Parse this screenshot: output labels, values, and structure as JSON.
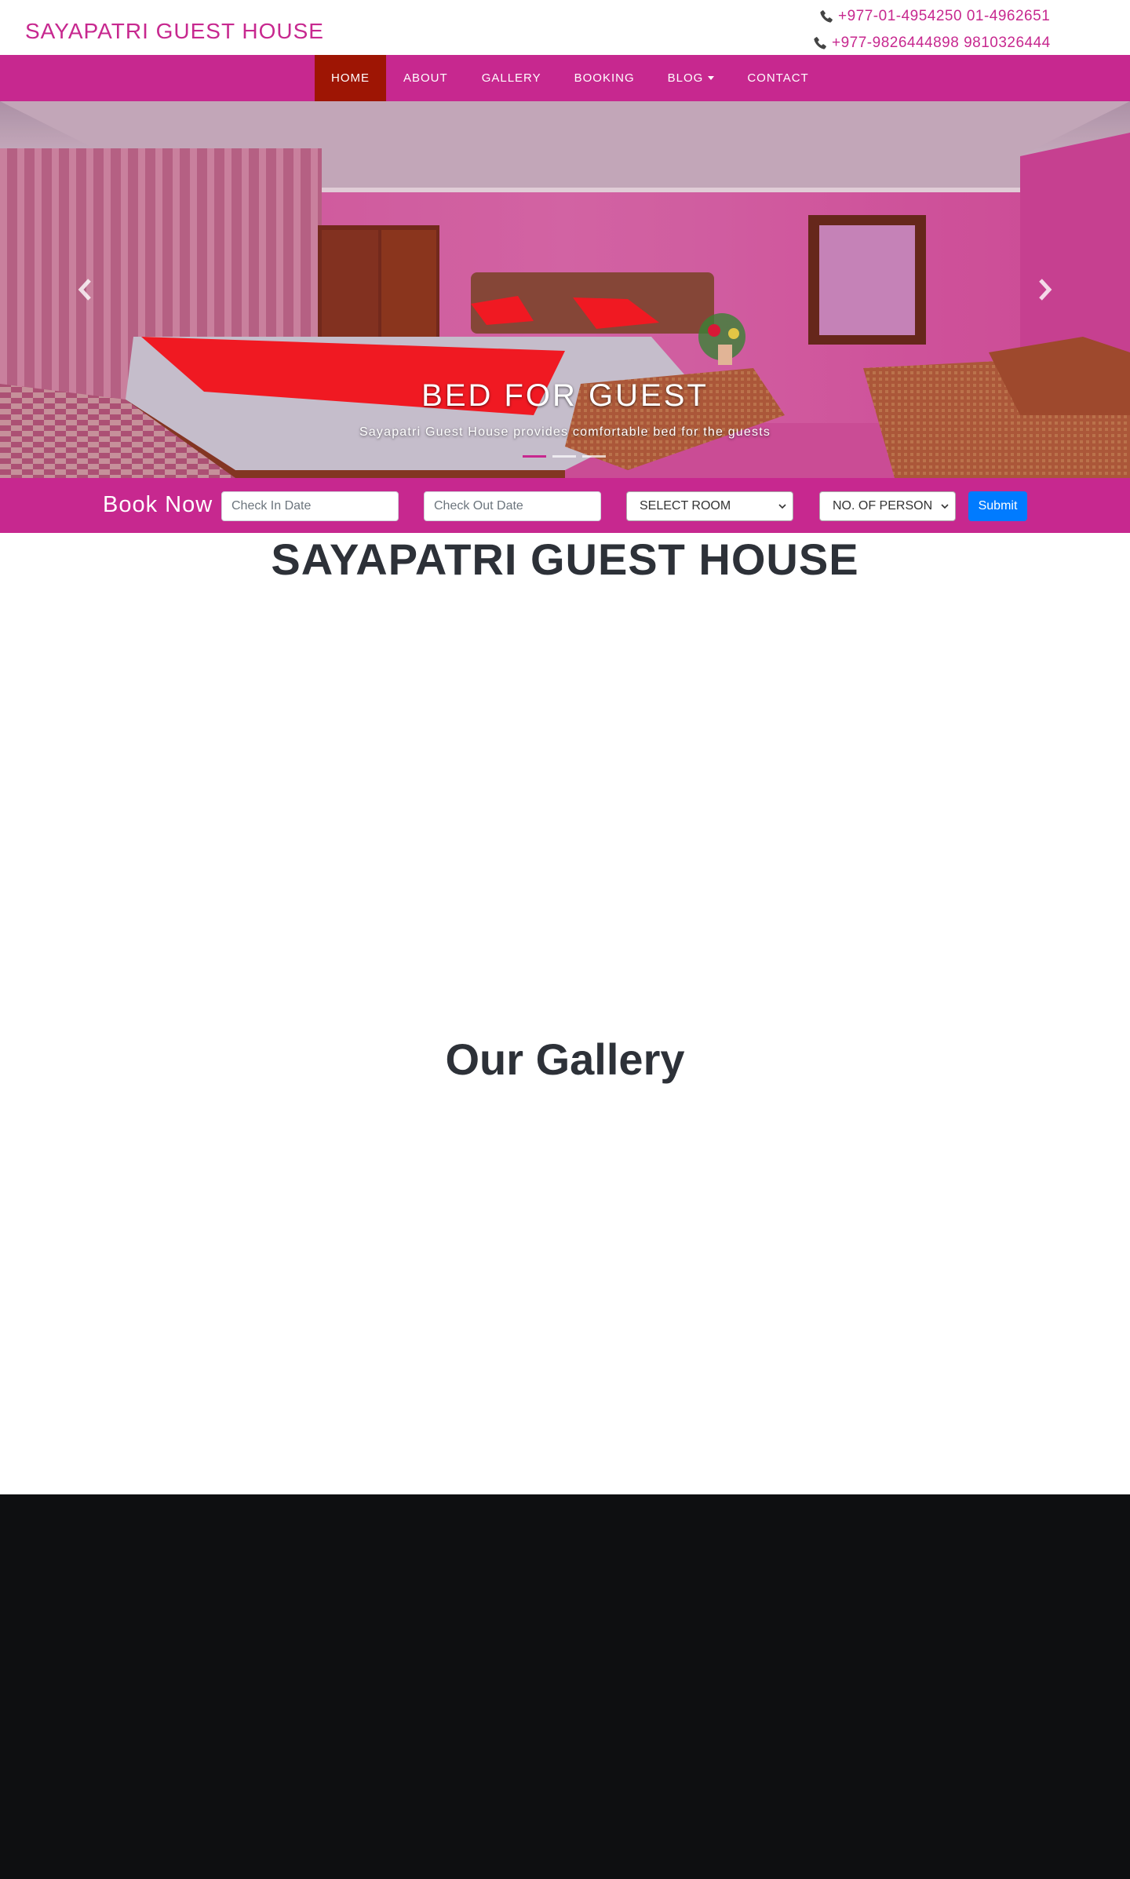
{
  "header": {
    "brand": "SAYAPATRI GUEST HOUSE",
    "phones": [
      {
        "icon": "phone-icon",
        "text": "+977-01-4954250 01-4962651"
      },
      {
        "icon": "phone-icon",
        "text": "+977-9826444898 9810326444"
      }
    ]
  },
  "nav": {
    "items": [
      {
        "label": "HOME",
        "active": true
      },
      {
        "label": "ABOUT"
      },
      {
        "label": "GALLERY"
      },
      {
        "label": "BOOKING"
      },
      {
        "label": "BLOG",
        "dropdown": true
      },
      {
        "label": "CONTACT"
      }
    ]
  },
  "hero": {
    "title": "BED FOR GUEST",
    "text": "Sayapatri Guest House provides comfortable bed for the guests",
    "slides": 3,
    "active_slide": 1,
    "prev_icon": "chevron-left-icon",
    "next_icon": "chevron-right-icon"
  },
  "booking": {
    "title": "Book Now",
    "check_in_placeholder": "Check In Date",
    "check_out_placeholder": "Check Out Date",
    "room_select": "SELECT ROOM",
    "person_select": "NO. OF PERSON",
    "submit": "Submit"
  },
  "main": {
    "title": "SAYAPATRI GUEST HOUSE",
    "gallery_title": "Our Gallery"
  },
  "colors": {
    "brand": "#c7288f",
    "nav_active": "#9e1504",
    "submit": "#007bff",
    "footer": "#0e0f11",
    "heading": "#2d3138"
  }
}
